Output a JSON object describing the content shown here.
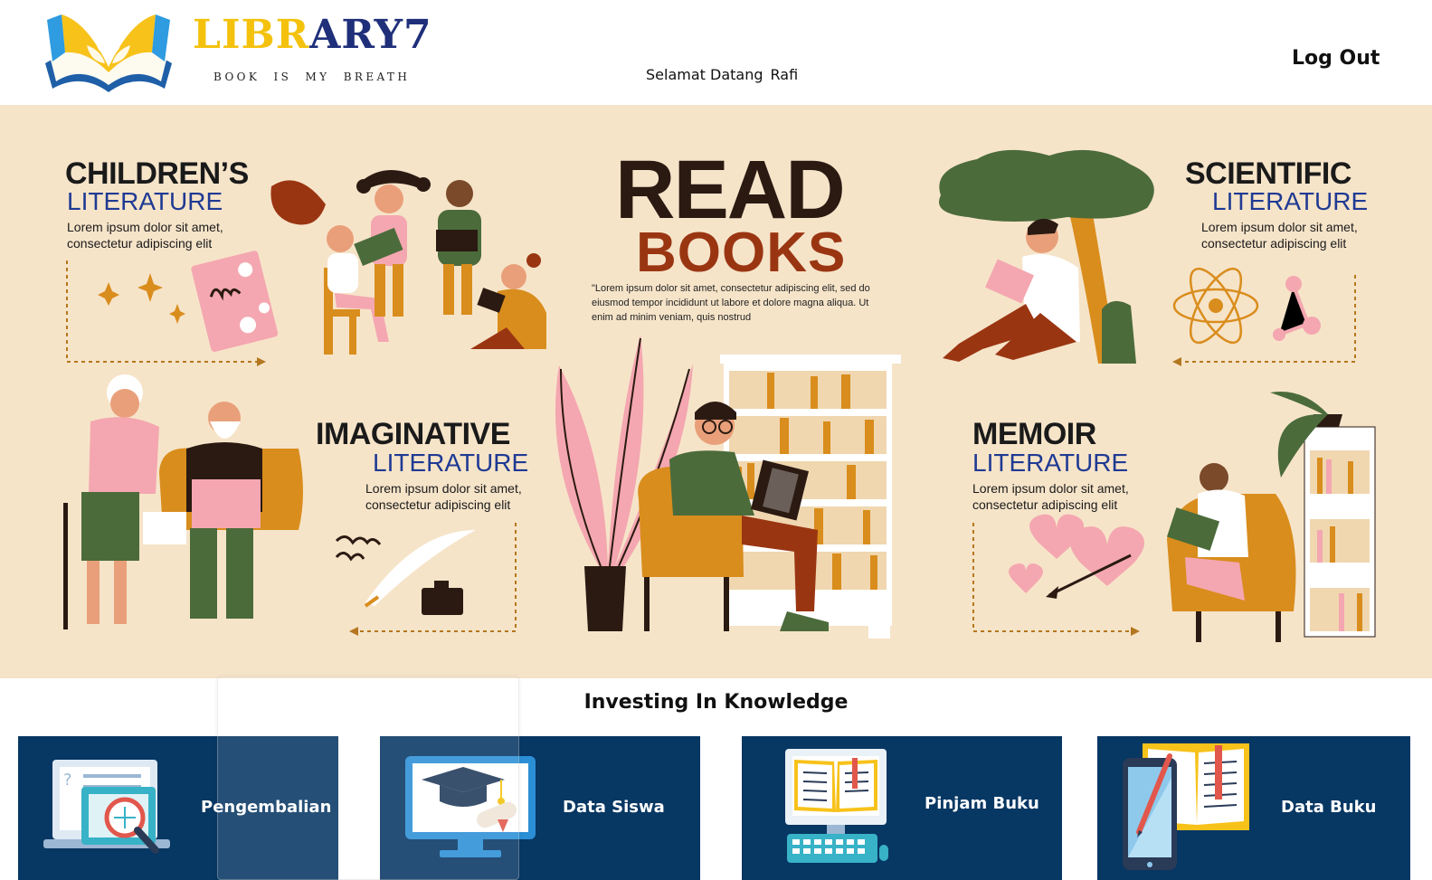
{
  "header": {
    "logo_part1": "LIBR",
    "logo_part2": "ARY7",
    "tagline": "BOOK IS MY BREATH",
    "welcome_prefix": "Selamat Datang",
    "user_name": "Rafi",
    "logout_label": "Log Out"
  },
  "hero": {
    "center_title": "READ",
    "center_subtitle": "BOOKS",
    "center_quote": "\"Lorem ipsum dolor sit amet, consectetur adipiscing elit, sed do eiusmod tempor incididunt ut labore et dolore magna aliqua. Ut enim ad minim veniam, quis nostrud",
    "categories": [
      {
        "title": "CHILDREN’S",
        "subtitle": "LITERATURE",
        "desc": "Lorem ipsum dolor sit amet, consectetur adipiscing elit"
      },
      {
        "title": "SCIENTIFIC",
        "subtitle": "LITERATURE",
        "desc": "Lorem ipsum dolor sit amet, consectetur adipiscing elit"
      },
      {
        "title": "IMAGINATIVE",
        "subtitle": "LITERATURE",
        "desc": "Lorem ipsum dolor sit amet, consectetur adipiscing elit"
      },
      {
        "title": "MEMOIR",
        "subtitle": "LITERATURE",
        "desc": "Lorem ipsum dolor sit amet, consectetur adipiscing elit"
      }
    ]
  },
  "section_title": "Investing In Knowledge",
  "tiles": [
    {
      "label": "Pengembalian",
      "icon": "magnifier-monitor-icon"
    },
    {
      "label": "Data Siswa",
      "icon": "graduation-monitor-icon"
    },
    {
      "label": "Pinjam Buku",
      "icon": "computer-book-icon"
    },
    {
      "label": "Data Buku",
      "icon": "tablet-book-icon"
    }
  ],
  "colors": {
    "tile_bg": "#073763",
    "hero_bg": "#f6e4c9",
    "logo_yellow": "#f4c20d",
    "logo_navy": "#1f2f7a",
    "subtitle_blue": "#1f3a93",
    "books_red": "#9a3512"
  }
}
